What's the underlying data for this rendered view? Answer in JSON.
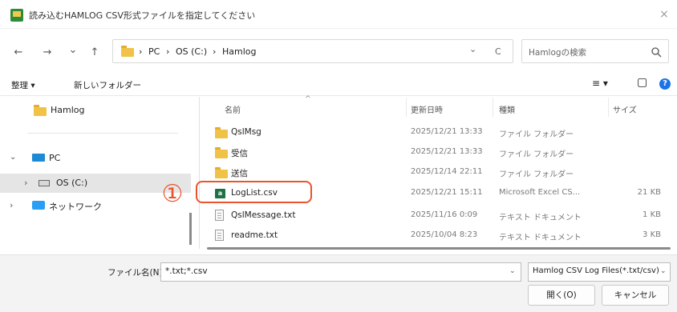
{
  "window": {
    "title": "読み込むHAMLOG CSV形式ファイルを指定してください",
    "close_glyph": "×"
  },
  "nav": {
    "back_glyph": "←",
    "forward_glyph": "→",
    "recent_glyph": "⌄",
    "up_glyph": "↑",
    "breadcrumb": [
      "PC",
      "OS (C:)",
      "Hamlog"
    ],
    "separator": "›",
    "dropdown_glyph": "⌄",
    "refresh_glyph": "C"
  },
  "search": {
    "placeholder": "Hamlogの検索"
  },
  "commandbar": {
    "organize_label": "整理 ▾",
    "new_folder_label": "新しいフォルダー",
    "view_glyph": "≡ ▾",
    "pane_glyph": "▢",
    "help_glyph": "?"
  },
  "sidebar": {
    "items": [
      {
        "label": "Hamlog",
        "expander": "",
        "icon": "folder-icon"
      },
      {
        "label": "PC",
        "expander": "⌄",
        "icon": "pc-icon"
      },
      {
        "label": "OS (C:)",
        "expander": "›",
        "icon": "drive-icon",
        "selected": true
      },
      {
        "label": "ネットワーク",
        "expander": "›",
        "icon": "network-icon"
      }
    ]
  },
  "filelist": {
    "columns": [
      "名前",
      "更新日時",
      "種類",
      "サイズ"
    ],
    "sort_indicator": "^",
    "rows": [
      {
        "name": "QslMsg",
        "date": "2025/12/21 13:33",
        "type": "ファイル フォルダー",
        "size": "",
        "icon": "folder-icon"
      },
      {
        "name": "受信",
        "date": "2025/12/21 13:33",
        "type": "ファイル フォルダー",
        "size": "",
        "icon": "folder-icon"
      },
      {
        "name": "送信",
        "date": "2025/12/14 22:11",
        "type": "ファイル フォルダー",
        "size": "",
        "icon": "folder-icon"
      },
      {
        "name": "LogList.csv",
        "date": "2025/12/21 15:11",
        "type": "Microsoft Excel CS...",
        "size": "21 KB",
        "icon": "excel-csv-icon"
      },
      {
        "name": "QslMessage.txt",
        "date": "2025/11/16 0:09",
        "type": "テキスト ドキュメント",
        "size": "1 KB",
        "icon": "text-file-icon"
      },
      {
        "name": "readme.txt",
        "date": "2025/10/04 8:23",
        "type": "テキスト ドキュメント",
        "size": "3 KB",
        "icon": "text-file-icon"
      }
    ]
  },
  "annotation": {
    "marker": "①",
    "color": "#e9542c"
  },
  "footer": {
    "filename_label": "ファイル名(N):",
    "filename_value": "*.txt;*.csv",
    "filter_value": "Hamlog CSV Log Files(*.txt/csv)",
    "open_label": "開く(O)",
    "cancel_label": "キャンセル"
  }
}
